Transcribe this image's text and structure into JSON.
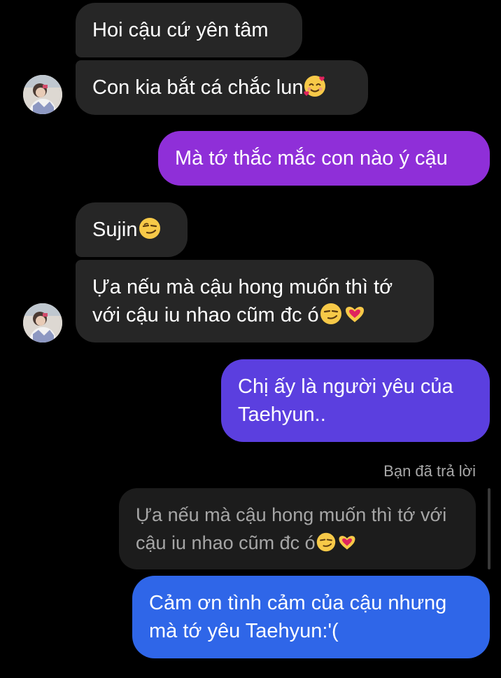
{
  "messages": [
    {
      "id": "m1",
      "side": "incoming",
      "text": "Hoi cậu cứ yên tâm",
      "emoji": []
    },
    {
      "id": "m2",
      "side": "incoming",
      "text": "Con kia bắt cá chắc lun",
      "emoji": [
        "smiling-face-with-hearts"
      ]
    },
    {
      "id": "m3",
      "side": "outgoing",
      "text": "Mà tớ thắc mắc con nào ý cậu",
      "color": "#8f2fd8",
      "emoji": []
    },
    {
      "id": "m4",
      "side": "incoming",
      "text": "Sujin",
      "emoji": [
        "smirking-face"
      ]
    },
    {
      "id": "m5",
      "side": "incoming",
      "line1": "Ựa nếu mà cậu hong muốn thì tớ",
      "line2": "với cậu iu nhao cũm đc ó",
      "emoji": [
        "smirking-face",
        "heart-hands"
      ]
    },
    {
      "id": "m6",
      "side": "outgoing",
      "line1": "Chị ấy là người yêu của",
      "line2": "Taehyun..",
      "color": "#5b3fdf",
      "emoji": []
    },
    {
      "id": "m7",
      "side": "outgoing",
      "line1": "Cảm ơn tình cảm của cậu nhưng",
      "line2": "mà tớ yêu Taehyun:'(",
      "color": "#2f66e8",
      "emoji": []
    }
  ],
  "reply": {
    "meta": "Bạn đã trả lời",
    "quoted_line1": "Ựa nếu mà cậu hong muốn thì tớ với",
    "quoted_line2": "cậu iu nhao cũm đc ó",
    "quoted_emoji": [
      "smirking-face",
      "heart-hands"
    ]
  },
  "colors": {
    "background": "#000000",
    "incoming_bubble": "#262626",
    "quoted_bubble": "#1c1c1c",
    "outgoing_purple": "#8f2fd8",
    "outgoing_indigo": "#5b3fdf",
    "outgoing_blue": "#2f66e8"
  },
  "avatars": [
    {
      "id": "avatar-1",
      "icon": "user-avatar"
    },
    {
      "id": "avatar-2",
      "icon": "user-avatar"
    }
  ]
}
